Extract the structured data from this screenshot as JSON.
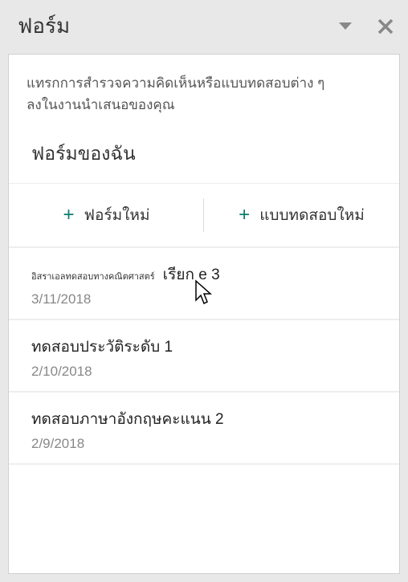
{
  "header": {
    "title": "ฟอร์ม"
  },
  "description": {
    "line1": "แทรกการสํารวจความคิดเห็นหรือแบบทดสอบต่าง ๆ",
    "line2": "ลงในงานนําเสนอของคุณ"
  },
  "section_title": "ฟอร์มของฉัน",
  "buttons": {
    "new_form": "ฟอร์มใหม่",
    "new_quiz": "แบบทดสอบใหม่"
  },
  "forms": [
    {
      "prefix": "อิสราเอลทดสอบทางคณิตศาสตร์",
      "title": "เรียก e 3",
      "date": "3/11/2018"
    },
    {
      "prefix": "",
      "title": "ทดสอบประวัติระดับ 1",
      "date": "2/10/2018"
    },
    {
      "prefix": "",
      "title": "ทดสอบภาษาอังกฤษคะแนน 2",
      "date": "2/9/2018"
    }
  ]
}
